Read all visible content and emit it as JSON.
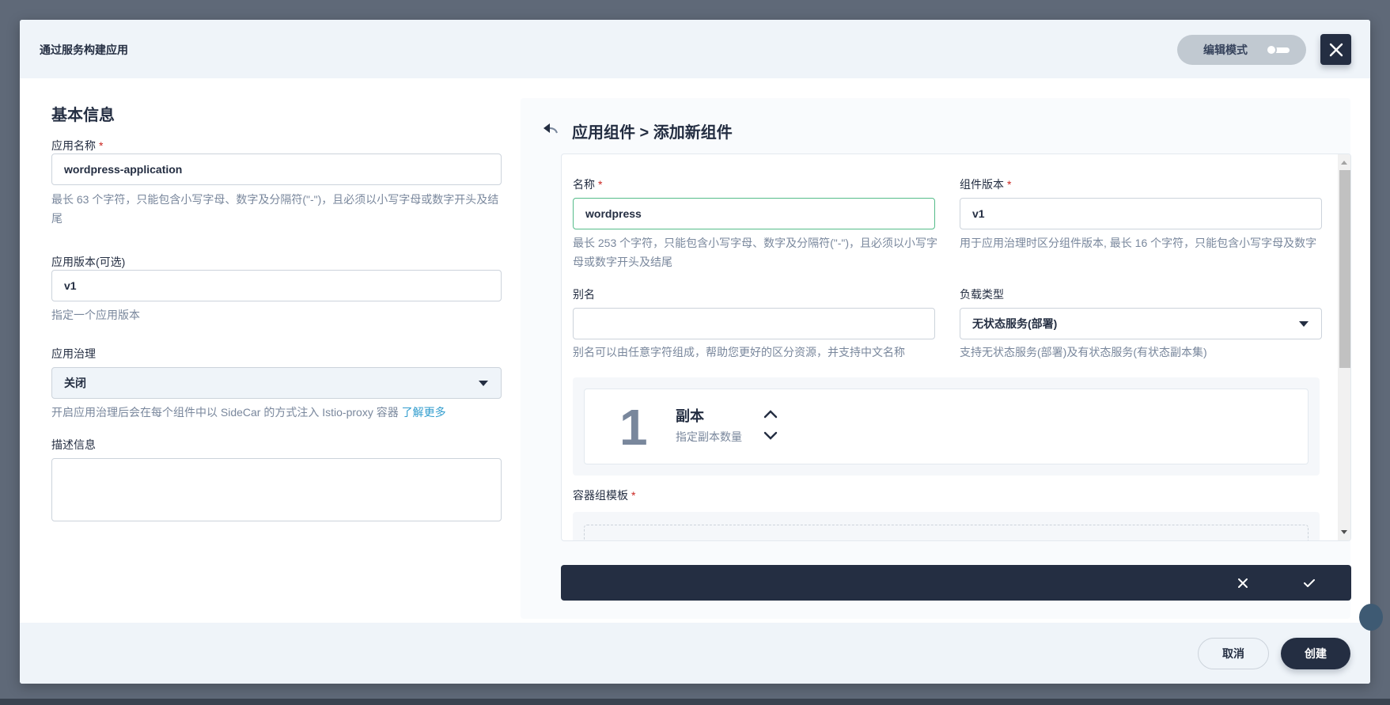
{
  "modal": {
    "title": "通过服务构建应用",
    "edit_mode_label": "编辑模式"
  },
  "basic_info": {
    "section_title": "基本信息",
    "app_name": {
      "label": "应用名称",
      "required_mark": "*",
      "value": "wordpress-application",
      "hint": "最长 63 个字符，只能包含小写字母、数字及分隔符(\"-\")，且必须以小写字母或数字开头及结尾"
    },
    "app_version": {
      "label": "应用版本(可选)",
      "value": "v1",
      "hint": "指定一个应用版本"
    },
    "governance": {
      "label": "应用治理",
      "selected": "关闭",
      "hint": "开启应用治理后会在每个组件中以 SideCar 的方式注入 Istio-proxy 容器",
      "learn_more": "了解更多"
    },
    "description": {
      "label": "描述信息",
      "value": ""
    }
  },
  "component": {
    "title": "应用组件 > 添加新组件",
    "name": {
      "label": "名称",
      "required_mark": "*",
      "value": "wordpress",
      "hint": "最长 253 个字符，只能包含小写字母、数字及分隔符(\"-\")，且必须以小写字母或数字开头及结尾"
    },
    "version": {
      "label": "组件版本",
      "required_mark": "*",
      "value": "v1",
      "hint": "用于应用治理时区分组件版本, 最长 16 个字符，只能包含小写字母及数字"
    },
    "alias": {
      "label": "别名",
      "value": "",
      "hint": "别名可以由任意字符组成，帮助您更好的区分资源，并支持中文名称"
    },
    "workload_type": {
      "label": "负载类型",
      "selected": "无状态服务(部署)",
      "hint": "支持无状态服务(部署)及有状态服务(有状态副本集)"
    },
    "replicas": {
      "count": "1",
      "label": "副本",
      "hint": "指定副本数量"
    },
    "pod_template": {
      "label": "容器组模板",
      "required_mark": "*"
    }
  },
  "footer": {
    "cancel_label": "取消",
    "create_label": "创建"
  },
  "colors": {
    "primary_dark": "#242e42",
    "required": "#ca2621",
    "focus_border": "#55bc8a",
    "link": "#329dce",
    "hint": "#79879c"
  }
}
